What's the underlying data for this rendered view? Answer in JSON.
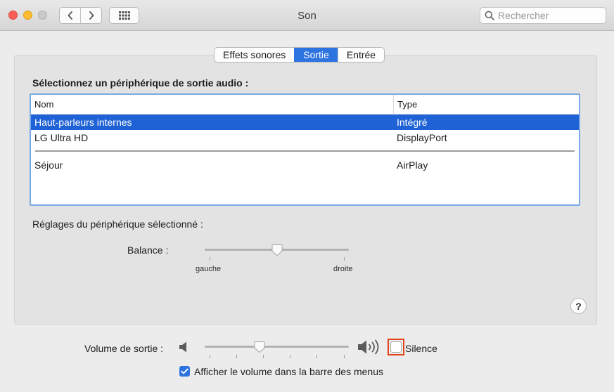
{
  "window": {
    "title": "Son"
  },
  "search": {
    "placeholder": "Rechercher"
  },
  "tabs": [
    {
      "label": "Effets sonores",
      "active": false
    },
    {
      "label": "Sortie",
      "active": true
    },
    {
      "label": "Entrée",
      "active": false
    }
  ],
  "output": {
    "section_title": "Sélectionnez un périphérique de sortie audio :",
    "columns": {
      "name": "Nom",
      "type": "Type"
    },
    "devices": [
      {
        "name": "Haut-parleurs internes",
        "type": "Intégré",
        "selected": true
      },
      {
        "name": "LG Ultra HD",
        "type": "DisplayPort",
        "selected": false
      },
      {
        "name": "Séjour",
        "type": "AirPlay",
        "selected": false
      }
    ]
  },
  "settings": {
    "title": "Réglages du périphérique sélectionné :",
    "balance_label": "Balance :",
    "balance_left_label": "gauche",
    "balance_right_label": "droite",
    "balance_value": 0.5
  },
  "volume": {
    "label": "Volume de sortie :",
    "value": 0.38,
    "mute_label": "Silence",
    "mute_checked": false
  },
  "menubar_volume": {
    "label": "Afficher le volume dans la barre des menus",
    "checked": true
  },
  "icons": {
    "back": "chevron-left-icon",
    "forward": "chevron-right-icon",
    "grid": "grid-icon",
    "search": "magnifier-icon",
    "volume_low": "speaker-low-icon",
    "volume_high": "speaker-high-icon",
    "help": "help-icon"
  },
  "colors": {
    "accent": "#2d74e0",
    "selection": "#1f62d6",
    "mute_highlight": "#e0441d"
  }
}
